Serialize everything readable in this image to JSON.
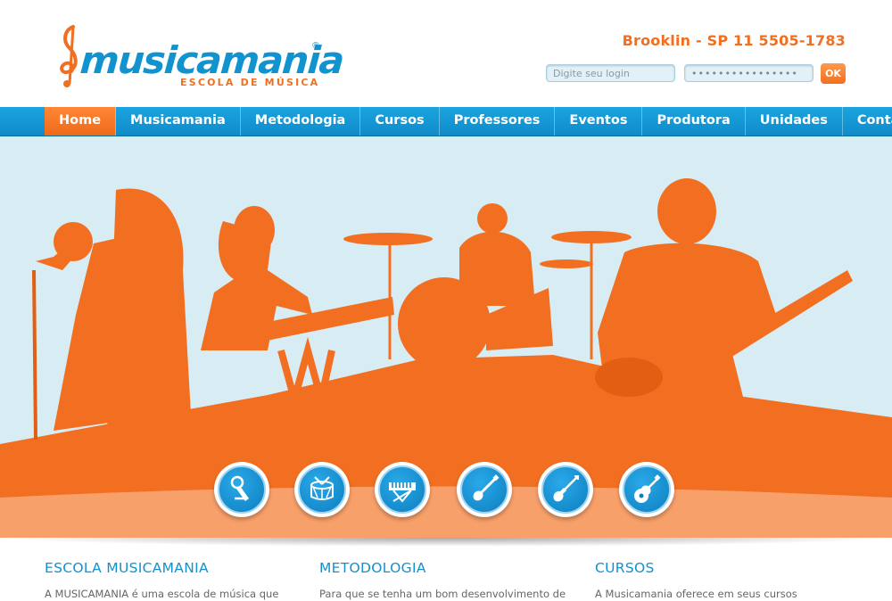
{
  "brand": {
    "name": "musicamania",
    "registered": "®",
    "tagline": "ESCOLA DE MÚSICA",
    "colors": {
      "blue": "#1193d0",
      "orange": "#f26f21",
      "sky": "#d8ecf4"
    }
  },
  "header": {
    "location_phone": "Brooklin - SP 11 5505-1783",
    "login": {
      "user_placeholder": "Digite seu login",
      "password_value": "••••••••••••••••",
      "submit_label": "OK"
    }
  },
  "nav": {
    "items": [
      {
        "label": "Home",
        "active": true
      },
      {
        "label": "Musicamania"
      },
      {
        "label": "Metodologia"
      },
      {
        "label": "Cursos"
      },
      {
        "label": "Professores"
      },
      {
        "label": "Eventos"
      },
      {
        "label": "Produtora"
      },
      {
        "label": "Unidades"
      },
      {
        "label": "Contato"
      }
    ]
  },
  "instrument_buttons": [
    {
      "icon": "microphone-icon"
    },
    {
      "icon": "drum-icon"
    },
    {
      "icon": "keyboard-icon"
    },
    {
      "icon": "electric-guitar-icon"
    },
    {
      "icon": "bass-guitar-icon"
    },
    {
      "icon": "acoustic-guitar-icon"
    }
  ],
  "sections": [
    {
      "title": "ESCOLA MUSICAMANIA",
      "text": "A MUSICAMANIA é uma escola de música que"
    },
    {
      "title": "METODOLOGIA",
      "text": "Para que se tenha um bom desenvolvimento de"
    },
    {
      "title": "CURSOS",
      "text": "A Musicamania oferece em seus cursos"
    }
  ]
}
